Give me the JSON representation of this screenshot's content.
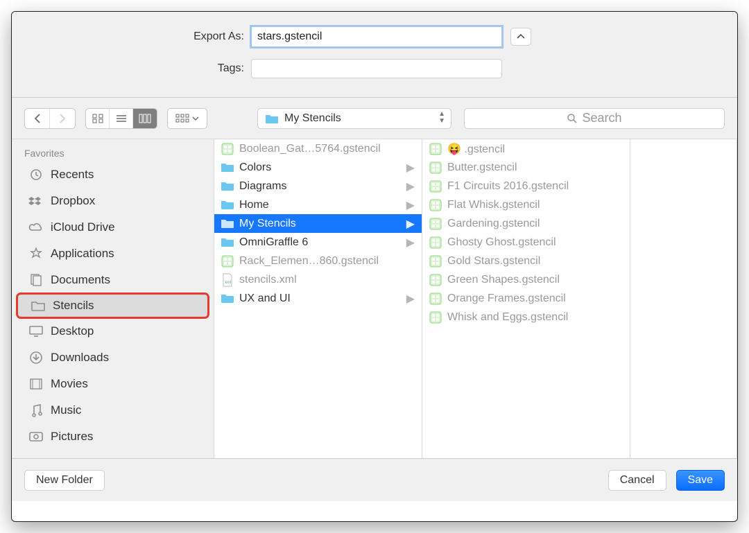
{
  "header": {
    "export_as_label": "Export As:",
    "export_as_value": "stars.gstencil",
    "tags_label": "Tags:"
  },
  "toolbar": {
    "location_label": "My Stencils",
    "search_placeholder": "Search"
  },
  "sidebar": {
    "favorites_header": "Favorites",
    "items": [
      {
        "label": "Recents",
        "icon": "clock"
      },
      {
        "label": "Dropbox",
        "icon": "dropbox"
      },
      {
        "label": "iCloud Drive",
        "icon": "cloud"
      },
      {
        "label": "Applications",
        "icon": "apps"
      },
      {
        "label": "Documents",
        "icon": "docs"
      },
      {
        "label": "Stencils",
        "icon": "folder",
        "selected": true,
        "highlighted": true
      },
      {
        "label": "Desktop",
        "icon": "desktop"
      },
      {
        "label": "Downloads",
        "icon": "download"
      },
      {
        "label": "Movies",
        "icon": "movies"
      },
      {
        "label": "Music",
        "icon": "music"
      },
      {
        "label": "Pictures",
        "icon": "pictures"
      }
    ]
  },
  "columns": {
    "col1": [
      {
        "label": "Boolean_Gat…5764.gstencil",
        "type": "stencil",
        "dim": true
      },
      {
        "label": "Colors",
        "type": "folder",
        "arrow": true
      },
      {
        "label": "Diagrams",
        "type": "folder",
        "arrow": true
      },
      {
        "label": "Home",
        "type": "folder",
        "arrow": true
      },
      {
        "label": "My Stencils",
        "type": "folder",
        "arrow": true,
        "selected": true
      },
      {
        "label": "OmniGraffle 6",
        "type": "folder",
        "arrow": true
      },
      {
        "label": "Rack_Elemen…860.gstencil",
        "type": "stencil",
        "dim": true
      },
      {
        "label": "stencils.xml",
        "type": "xml",
        "dim": true
      },
      {
        "label": "UX and UI",
        "type": "folder",
        "arrow": true
      }
    ],
    "col2": [
      {
        "label": "😝 .gstencil",
        "type": "stencil",
        "dim": true
      },
      {
        "label": "Butter.gstencil",
        "type": "stencil",
        "dim": true
      },
      {
        "label": "F1 Circuits 2016.gstencil",
        "type": "stencil",
        "dim": true
      },
      {
        "label": "Flat Whisk.gstencil",
        "type": "stencil",
        "dim": true
      },
      {
        "label": "Gardening.gstencil",
        "type": "stencil",
        "dim": true
      },
      {
        "label": "Ghosty Ghost.gstencil",
        "type": "stencil",
        "dim": true
      },
      {
        "label": "Gold Stars.gstencil",
        "type": "stencil",
        "dim": true
      },
      {
        "label": "Green Shapes.gstencil",
        "type": "stencil",
        "dim": true
      },
      {
        "label": "Orange Frames.gstencil",
        "type": "stencil",
        "dim": true
      },
      {
        "label": "Whisk and Eggs.gstencil",
        "type": "stencil",
        "dim": true
      }
    ]
  },
  "bottom": {
    "new_folder": "New Folder",
    "cancel": "Cancel",
    "save": "Save"
  }
}
